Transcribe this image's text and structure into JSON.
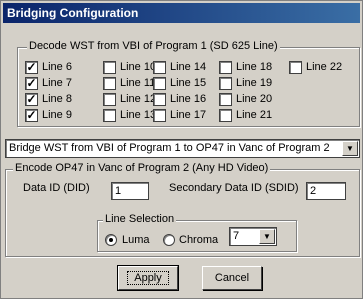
{
  "window": {
    "title": "Bridging Configuration"
  },
  "decode_group": {
    "title": "Decode WST from VBI of Program 1 (SD 625 Line)",
    "lines": [
      {
        "label": "Line 6",
        "checked": true
      },
      {
        "label": "Line 7",
        "checked": true
      },
      {
        "label": "Line 8",
        "checked": true
      },
      {
        "label": "Line 9",
        "checked": true
      },
      {
        "label": "Line 10",
        "checked": false
      },
      {
        "label": "Line 11",
        "checked": false
      },
      {
        "label": "Line 12",
        "checked": false
      },
      {
        "label": "Line 13",
        "checked": false
      },
      {
        "label": "Line 14",
        "checked": false
      },
      {
        "label": "Line 15",
        "checked": false
      },
      {
        "label": "Line 16",
        "checked": false
      },
      {
        "label": "Line 17",
        "checked": false
      },
      {
        "label": "Line 18",
        "checked": false
      },
      {
        "label": "Line 19",
        "checked": false
      },
      {
        "label": "Line 20",
        "checked": false
      },
      {
        "label": "Line 21",
        "checked": false
      },
      {
        "label": "Line 22",
        "checked": false
      }
    ]
  },
  "bridge_select": {
    "value": "Bridge WST from VBI of Program 1 to OP47 in Vanc of Program 2"
  },
  "encode_group": {
    "title": "Encode OP47 in Vanc of Program 2 (Any HD Video)",
    "data_id_label": "Data ID (DID)",
    "data_id_value": "1",
    "sdid_label": "Secondary Data ID (SDID)",
    "sdid_value": "2"
  },
  "line_selection": {
    "title": "Line Selection",
    "luma_label": "Luma",
    "chroma_label": "Chroma",
    "selected": "luma",
    "line_value": "7"
  },
  "buttons": {
    "apply": "Apply",
    "cancel": "Cancel"
  }
}
